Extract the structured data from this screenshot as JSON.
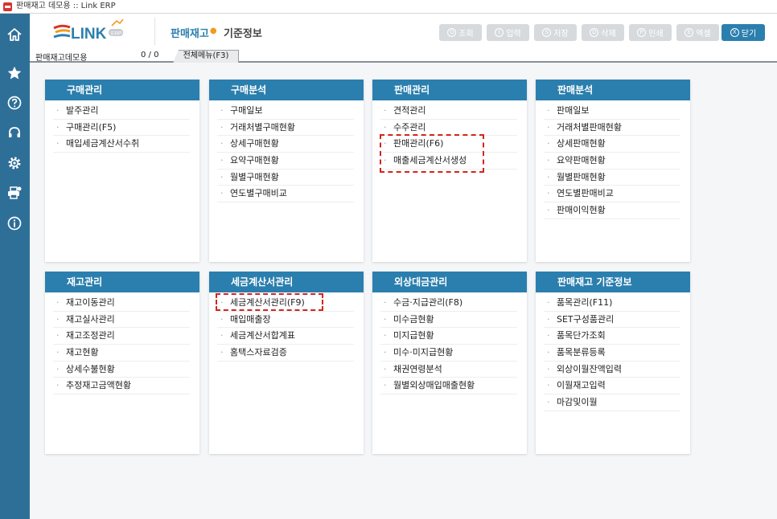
{
  "window": {
    "title": "판매재고 데모용 :: Link ERP"
  },
  "header": {
    "logo_text": "LINK",
    "logo_badge": "ERP",
    "tabs": [
      {
        "label": "판매재고",
        "active": true
      },
      {
        "label": "기준정보",
        "active": false
      }
    ],
    "buttons": [
      {
        "icon": "Q",
        "label": "조회"
      },
      {
        "icon": "I",
        "label": "입력"
      },
      {
        "icon": "S",
        "label": "저장"
      },
      {
        "icon": "D",
        "label": "삭제"
      },
      {
        "icon": "P",
        "label": "인쇄"
      },
      {
        "icon": "E",
        "label": "엑셀"
      },
      {
        "icon": "X",
        "label": "닫기"
      }
    ]
  },
  "tabstrip": {
    "label": "판매재고데모용",
    "count": "0 / 0",
    "all_menu": "전체메뉴(F3)"
  },
  "sidebar": {
    "icons": [
      "home-icon",
      "star-icon",
      "help-icon",
      "headset-icon",
      "gear-icon",
      "printer-icon",
      "info-icon"
    ]
  },
  "colors": {
    "brand": "#2b7fae",
    "sidebar": "#2e6f98",
    "highlight": "#d4241d",
    "accent": "#f29b1d"
  },
  "cards": [
    {
      "title": "구매관리",
      "items": [
        "발주관리",
        "구매관리(F5)",
        "매입세금계산서수취"
      ]
    },
    {
      "title": "구매분석",
      "items": [
        "구매일보",
        "거래처별구매현황",
        "상세구매현황",
        "요약구매현황",
        "월별구매현황",
        "연도별구매비교"
      ]
    },
    {
      "title": "판매관리",
      "items": [
        "견적관리",
        "수주관리",
        "판매관리(F6)",
        "매출세금계산서생성"
      ]
    },
    {
      "title": "판매분석",
      "items": [
        "판매일보",
        "거래처별판매현황",
        "상세판매현황",
        "요약판매현황",
        "월별판매현황",
        "연도별판매비교",
        "판매이익현황"
      ]
    },
    {
      "title": "재고관리",
      "items": [
        "재고이동관리",
        "재고실사관리",
        "재고조정관리",
        "재고현황",
        "상세수불현황",
        "추정재고금액현황"
      ]
    },
    {
      "title": "세금계산서관리",
      "items": [
        "세금계산서관리(F9)",
        "매입매출장",
        "세금계산서합계표",
        "홈택스자료검증"
      ]
    },
    {
      "title": "외상대금관리",
      "items": [
        "수금·지급관리(F8)",
        "미수금현황",
        "미지급현황",
        "미수·미지급현황",
        "채권연령분석",
        "월별외상매입매출현황"
      ]
    },
    {
      "title": "판매재고 기준정보",
      "items": [
        "품목관리(F11)",
        "SET구성품관리",
        "품목단가조회",
        "품목분류등록",
        "외상이월잔액입력",
        "이월재고입력",
        "마감및이월"
      ]
    }
  ]
}
